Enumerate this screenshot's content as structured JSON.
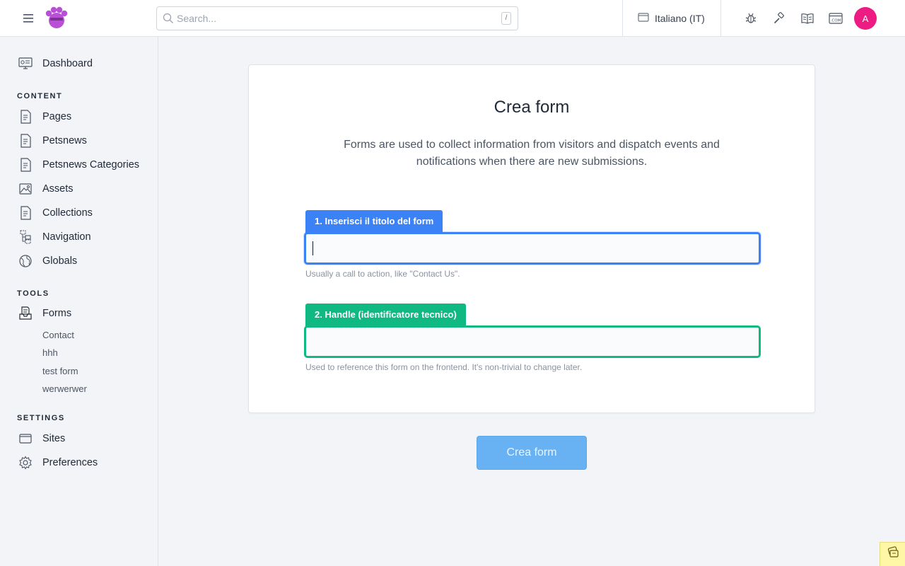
{
  "header": {
    "search": {
      "placeholder": "Search...",
      "shortcut": "/"
    },
    "site": {
      "label": "Italiano (IT)"
    },
    "avatar": {
      "initial": "A",
      "color": "#ec1c82"
    }
  },
  "sidebar": {
    "dashboard": "Dashboard",
    "sections": {
      "content": "CONTENT",
      "tools": "TOOLS",
      "settings": "SETTINGS"
    },
    "content_items": [
      "Pages",
      "Petsnews",
      "Petsnews Categories",
      "Assets",
      "Collections",
      "Navigation",
      "Globals"
    ],
    "tools_items": [
      "Forms"
    ],
    "forms_children": [
      "Contact",
      "hhh",
      "test form",
      "werwerwer"
    ],
    "settings_items": [
      "Sites",
      "Preferences"
    ]
  },
  "main": {
    "title": "Crea form",
    "description": "Forms are used to collect information from visitors and dispatch events and notifications when there are new submissions.",
    "title_field": {
      "tag": "1. Inserisci il titolo del form",
      "value": "",
      "help": "Usually a call to action, like \"Contact Us\"."
    },
    "handle_field": {
      "tag": "2. Handle (identificatore tecnico)",
      "value": "",
      "help": "Used to reference this form on the frontend. It's non-trivial to change later."
    },
    "submit_label": "Crea form"
  },
  "colors": {
    "blue": "#3b82f6",
    "green": "#10b981",
    "button": "#68b2f3"
  }
}
